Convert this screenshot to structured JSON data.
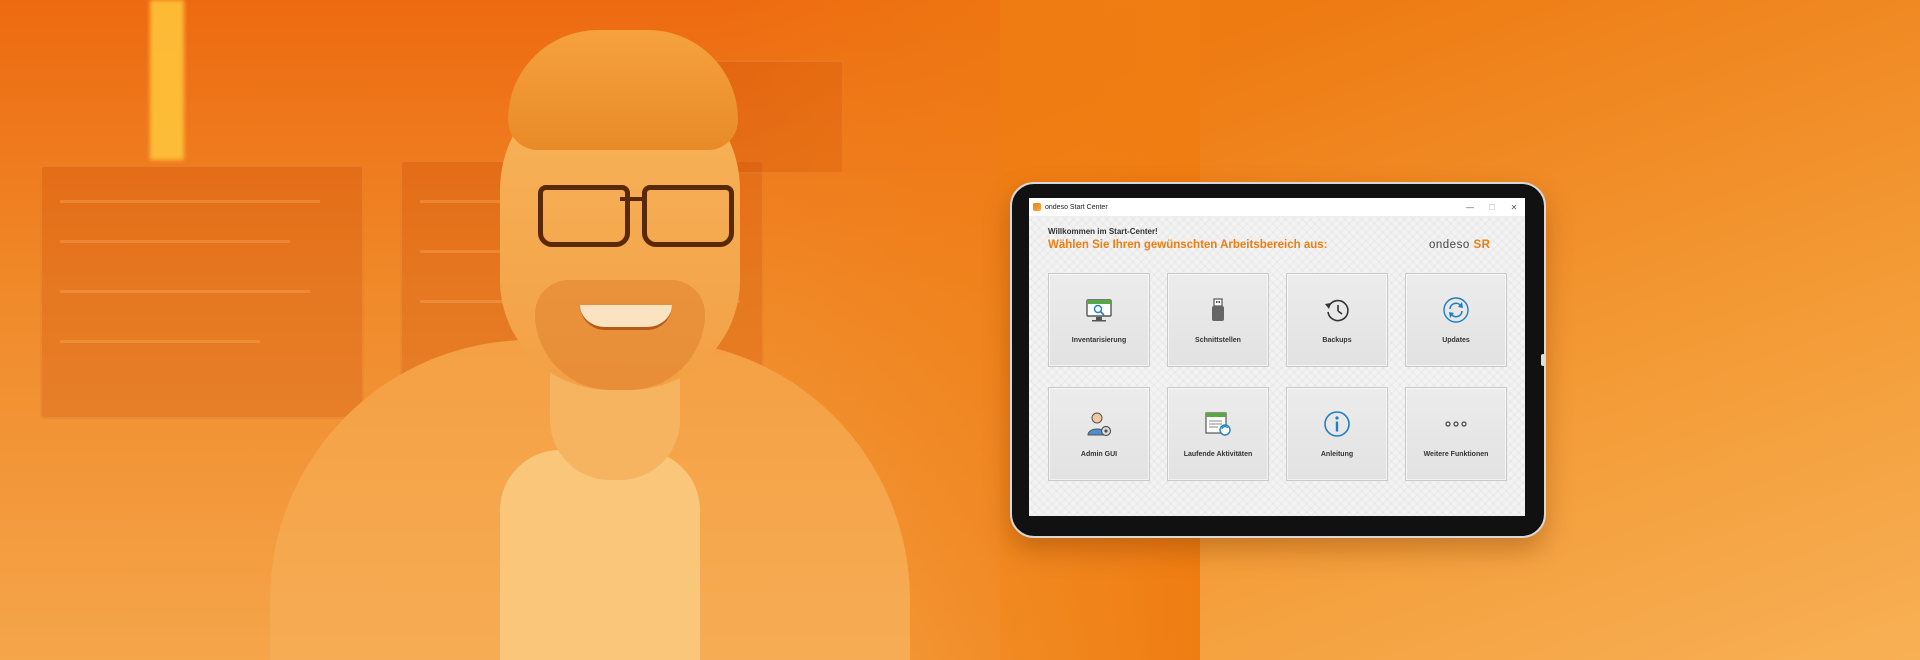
{
  "window": {
    "title": "ondeso Start Center",
    "controls": [
      "—",
      "☐",
      "✕"
    ]
  },
  "start_center": {
    "welcome": "Willkommen im Start-Center!",
    "heading": "Wählen Sie Ihren gewünschten Arbeitsbereich aus:",
    "logo": {
      "main": "ondeso",
      "suffix": "SR"
    },
    "tiles": [
      {
        "label": "Inventarisierung",
        "icon": "inventory-monitor-icon"
      },
      {
        "label": "Schnittstellen",
        "icon": "usb-stick-icon"
      },
      {
        "label": "Backups",
        "icon": "backup-clock-icon"
      },
      {
        "label": "Updates",
        "icon": "update-sync-icon"
      },
      {
        "label": "Admin GUI",
        "icon": "admin-user-gear-icon"
      },
      {
        "label": "Laufende Aktivitäten",
        "icon": "activity-window-icon"
      },
      {
        "label": "Anleitung",
        "icon": "info-icon"
      },
      {
        "label": "Weitere Funktionen",
        "icon": "more-dots-icon"
      }
    ]
  },
  "colors": {
    "accent": "#ef7d10",
    "background": "#f07f12"
  }
}
